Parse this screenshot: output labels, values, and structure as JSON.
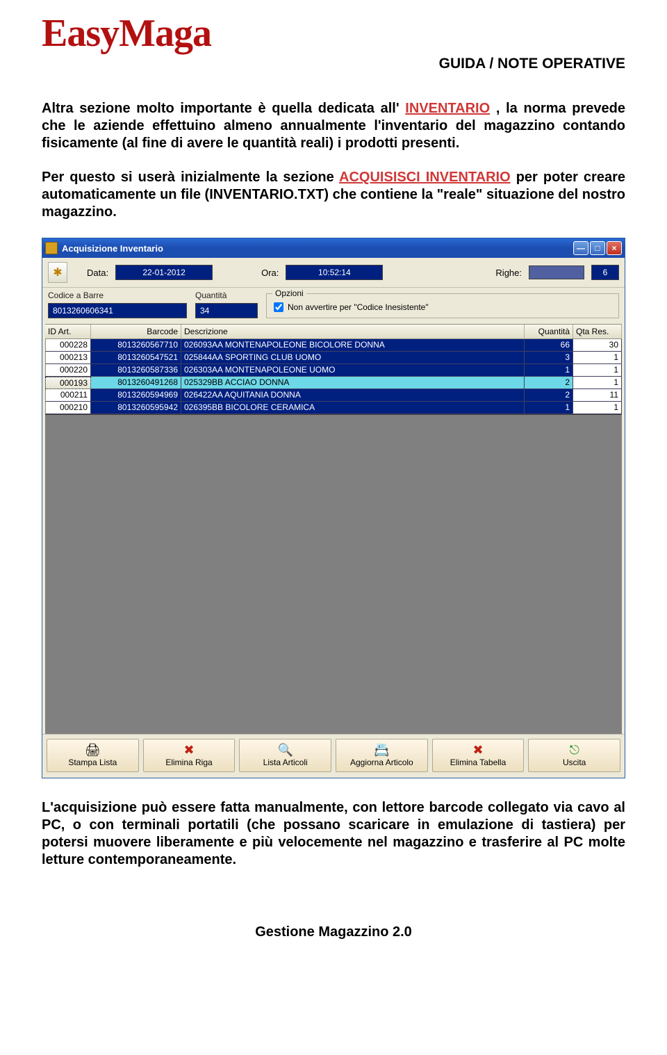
{
  "header": {
    "logo_text": "EasyMaga",
    "subtitle": "GUIDA / NOTE OPERATIVE"
  },
  "paragraph1": {
    "pre": "Altra sezione molto importante è quella dedicata all' ",
    "link": "INVENTARIO",
    "post": " , la norma prevede che le aziende effettuino almeno annualmente l'inventario del magazzino contando fisicamente (al fine di avere le quantità reali) i prodotti presenti."
  },
  "paragraph2": {
    "pre": "Per questo si userà inizialmente la sezione ",
    "link": "ACQUISISCI INVENTARIO",
    "post": " per poter creare automaticamente un file (INVENTARIO.TXT) che contiene la \"reale\" situazione del nostro magazzino."
  },
  "window": {
    "title": "Acquisizione Inventario",
    "fields": {
      "data_label": "Data:",
      "data_value": "22-01-2012",
      "ora_label": "Ora:",
      "ora_value": "10:52:14",
      "righe_label": "Righe:",
      "righe_value": "6",
      "barcode_label": "Codice a Barre",
      "barcode_value": "8013260606341",
      "qty_label": "Quantità",
      "qty_value": "34",
      "opz_label": "Opzioni",
      "opz_checkbox": "Non avvertire per \"Codice Inesistente\""
    },
    "grid": {
      "headers": {
        "id": "ID Art.",
        "barcode": "Barcode",
        "desc": "Descrizione",
        "qty": "Quantità",
        "qtares": "Qta Res."
      },
      "rows": [
        {
          "id": "000228",
          "barcode": "8013260567710",
          "desc": "026093AA MONTENAPOLEONE BICOLORE DONNA",
          "qty": "66",
          "qtares": "30",
          "selected": false
        },
        {
          "id": "000213",
          "barcode": "8013260547521",
          "desc": "025844AA SPORTING CLUB UOMO",
          "qty": "3",
          "qtares": "1",
          "selected": false
        },
        {
          "id": "000220",
          "barcode": "8013260587336",
          "desc": "026303AA MONTENAPOLEONE UOMO",
          "qty": "1",
          "qtares": "1",
          "selected": false
        },
        {
          "id": "000193",
          "barcode": "8013260491268",
          "desc": "025329BB ACCIAO DONNA",
          "qty": "2",
          "qtares": "1",
          "selected": true
        },
        {
          "id": "000211",
          "barcode": "8013260594969",
          "desc": "026422AA AQUITANIA DONNA",
          "qty": "2",
          "qtares": "11",
          "selected": false
        },
        {
          "id": "000210",
          "barcode": "8013260595942",
          "desc": "026395BB  BICOLORE CERAMICA",
          "qty": "1",
          "qtares": "1",
          "selected": false
        }
      ]
    },
    "buttons": {
      "stampa": "Stampa Lista",
      "elimina_riga": "Elimina Riga",
      "lista": "Lista Articoli",
      "aggiorna": "Aggiorna Articolo",
      "elimina_tab": "Elimina Tabella",
      "uscita": "Uscita"
    }
  },
  "paragraph3": "L'acquisizione può essere fatta manualmente, con lettore barcode collegato via cavo al PC, o con terminali portatili (che possano scaricare in emulazione di tastiera) per potersi muovere liberamente e più velocemente nel magazzino e trasferire al PC molte letture contemporaneamente.",
  "footer": "Gestione Magazzino  2.0"
}
